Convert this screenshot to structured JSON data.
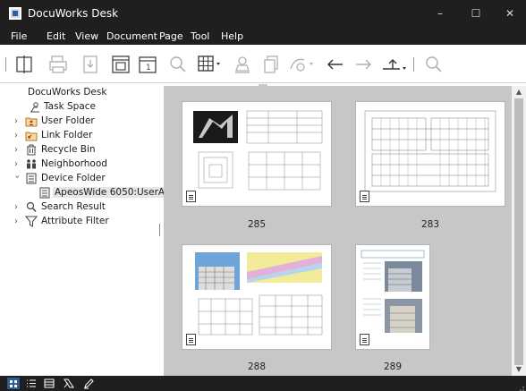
{
  "window": {
    "title": "DocuWorks Desk",
    "controls": {
      "minimize": "–",
      "maximize": "☐",
      "close": "✕"
    }
  },
  "menu": [
    "File",
    "Edit",
    "View",
    "Document",
    "Page",
    "Tool",
    "Help"
  ],
  "toolbar": {
    "icons": [
      "split-icon",
      "print-icon",
      "import-icon",
      "viewer-icon",
      "annotation-icon",
      "search-icon",
      "grid-view-icon",
      "user-stamp-icon",
      "merge-icon",
      "send-icon",
      "back-arrow-icon",
      "forward-arrow-icon",
      "up-folder-icon",
      "search-box-icon"
    ]
  },
  "tree": {
    "root": "DocuWorks Desk",
    "items": [
      {
        "label": "Task Space",
        "icon": "task-space-icon",
        "expandable": false
      },
      {
        "label": "User Folder",
        "icon": "user-folder-icon",
        "expandable": true
      },
      {
        "label": "Link Folder",
        "icon": "link-folder-icon",
        "expandable": true
      },
      {
        "label": "Recycle Bin",
        "icon": "recycle-bin-icon",
        "expandable": true
      },
      {
        "label": "Neighborhood",
        "icon": "neighborhood-icon",
        "expandable": true
      },
      {
        "label": "Device Folder",
        "icon": "device-folder-icon",
        "expandable": true,
        "expanded": true
      },
      {
        "label": "ApeosWide 6050:UserA",
        "icon": "device-icon",
        "expandable": false,
        "selected": true
      },
      {
        "label": "Search Result",
        "icon": "search-result-icon",
        "expandable": true
      },
      {
        "label": "Attribute Filter",
        "icon": "filter-icon",
        "expandable": true
      }
    ]
  },
  "documents": [
    {
      "label": "285"
    },
    {
      "label": "283"
    },
    {
      "label": "288"
    },
    {
      "label": "289"
    }
  ],
  "colors": {
    "chrome": "#1f1f1f",
    "canvas": "#c7c7c7",
    "accent": "#2e5c8f"
  }
}
